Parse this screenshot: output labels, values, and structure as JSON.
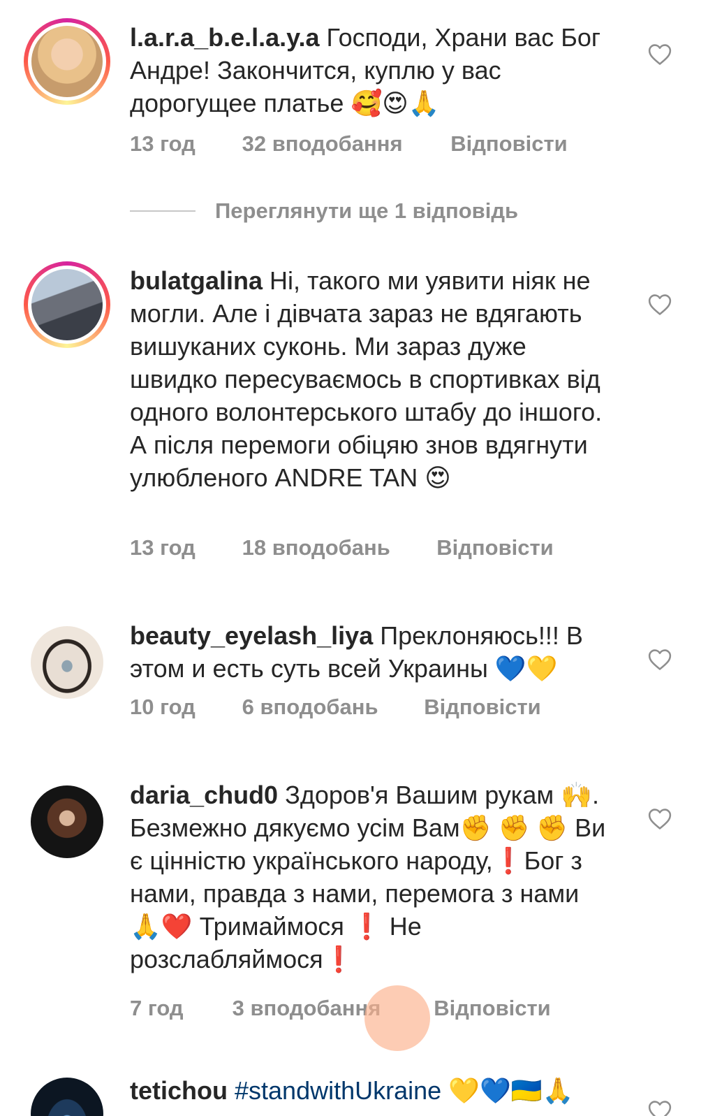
{
  "comments": [
    {
      "username": "l.a.r.a_b.e.l.a.y.a",
      "text": "Господи, Храни вас Бог Андре! Закончится, куплю у вас дорогущее платье 🥰😍🙏",
      "time": "13 год",
      "likes": "32 вподобання",
      "reply": "Відповісти"
    },
    {
      "username": "bulatgalina",
      "text": "Ні, такого ми уявити ніяк не могли. Але і дівчата зараз не вдягають вишуканих суконь. Ми зараз дуже швидко пересуваємось в спортивках від одного волонтерського штабу до іншого. А після перемоги обіцяю знов вдягнути улюбленого ANDRE TAN 😍",
      "time": "13 год",
      "likes": "18 вподобань",
      "reply": "Відповісти"
    },
    {
      "username": "beauty_eyelash_liya",
      "text": "Преклоняюсь!!! В этом и есть суть всей Украины 💙💛",
      "time": "10 год",
      "likes": "6 вподобань",
      "reply": "Відповісти"
    },
    {
      "username": "daria_chud0",
      "text": "Здоров'я Вашим рукам 🙌. Безмежно дякуємо усім Вам✊ ✊ ✊ Ви є цінністю українського народу,❗Бог з нами, правда з нами, перемога з нами 🙏❤️ Тримаймося ❗ Не розслабляймося❗",
      "time": "7 год",
      "likes": "3 вподобання",
      "reply": "Відповісти"
    },
    {
      "username": "tetichou",
      "text": "#standwithUkraine 💛💙🇺🇦🙏"
    }
  ],
  "view_more_replies": "Переглянути ще 1 відповідь",
  "colors": {
    "text": "#262626",
    "secondary": "#8e8e8e",
    "story_ring": "#d6249f",
    "hashtag": "#00376b"
  },
  "icons": {
    "like": "heart-outline-icon"
  }
}
